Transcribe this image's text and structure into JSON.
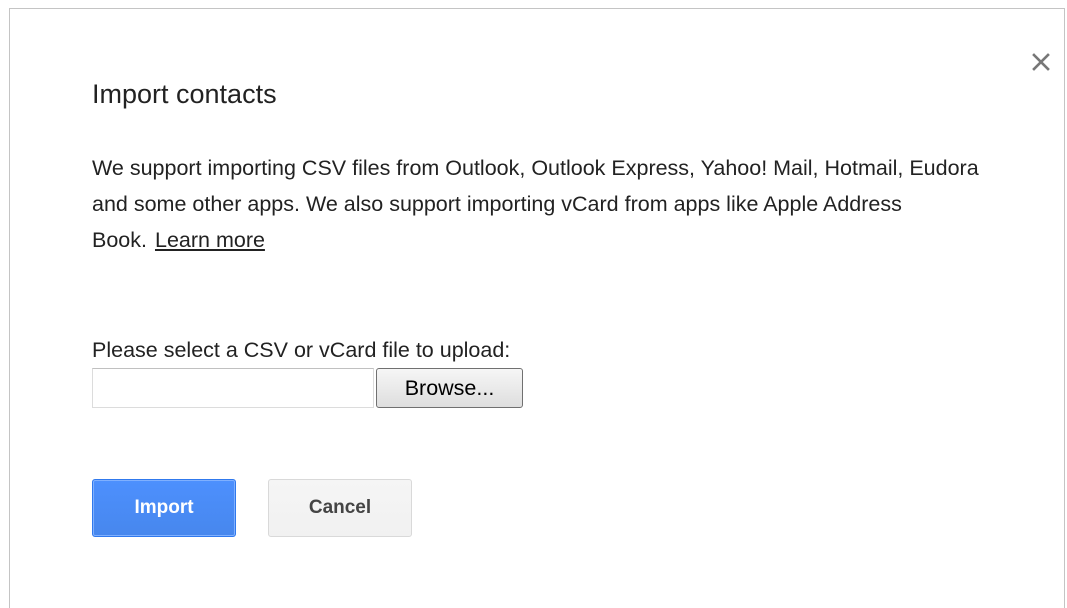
{
  "dialog": {
    "title": "Import contacts",
    "description": "We support importing CSV files from Outlook, Outlook Express, Yahoo! Mail, Hotmail, Eudora and some other apps. We also support importing vCard from apps like Apple Address Book.",
    "learn_more_label": "Learn more",
    "close_icon": "close-icon",
    "upload": {
      "label": "Please select a CSV or vCard file to upload:",
      "file_value": "",
      "browse_label": "Browse..."
    },
    "actions": {
      "import_label": "Import",
      "cancel_label": "Cancel"
    }
  },
  "colors": {
    "primary_button": "#4d90fe",
    "primary_border": "#3079ed",
    "secondary_button": "#f5f5f5",
    "text": "#222222"
  }
}
